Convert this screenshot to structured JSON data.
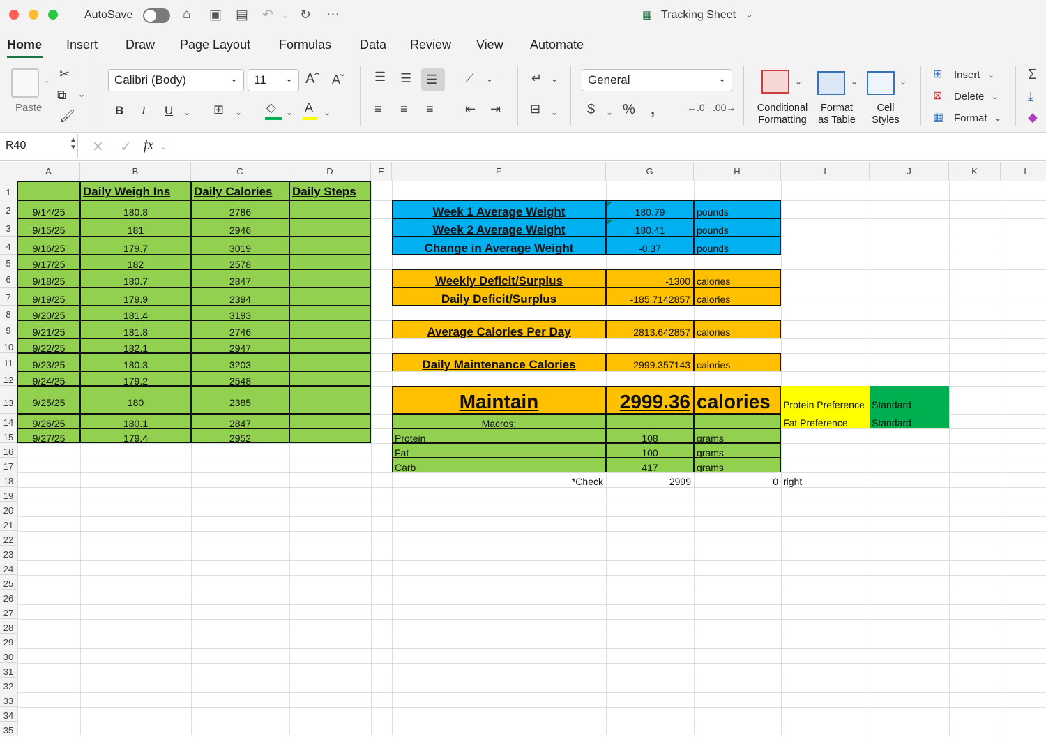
{
  "titlebar": {
    "autosave_label": "AutoSave",
    "document_title": "Tracking Sheet",
    "colors": {
      "close": "#fe5f57",
      "minimize": "#febc2e",
      "maximize": "#28c840"
    }
  },
  "tabs": [
    "Home",
    "Insert",
    "Draw",
    "Page Layout",
    "Formulas",
    "Data",
    "Review",
    "View",
    "Automate"
  ],
  "ribbon": {
    "paste_label": "Paste",
    "font_name": "Calibri (Body)",
    "font_size": "11",
    "number_format": "General",
    "conditional_formatting": [
      "Conditional",
      "Formatting"
    ],
    "format_as_table": [
      "Format",
      "as Table"
    ],
    "cell_styles": [
      "Cell",
      "Styles"
    ],
    "insert_label": "Insert",
    "delete_label": "Delete",
    "format_label": "Format",
    "bold": "B",
    "italic": "I",
    "underline": "U"
  },
  "formula_bar": {
    "name_box": "R40",
    "fx": "fx",
    "formula": ""
  },
  "columns": [
    "A",
    "B",
    "C",
    "D",
    "E",
    "F",
    "G",
    "H",
    "I",
    "J",
    "K",
    "L"
  ],
  "rows": [
    "1",
    "2",
    "3",
    "4",
    "5",
    "6",
    "7",
    "8",
    "9",
    "10",
    "11",
    "12",
    "13",
    "14",
    "15",
    "16",
    "17",
    "18",
    "19",
    "20",
    "21",
    "22",
    "23",
    "24",
    "25",
    "26",
    "27",
    "28",
    "29",
    "30",
    "31",
    "32",
    "33",
    "34",
    "35"
  ],
  "log": {
    "headers": [
      "Daily Weigh Ins",
      "Daily Calories",
      "Daily Steps"
    ],
    "entries": [
      {
        "date": "9/14/25",
        "weight": "180.8",
        "calories": "2786"
      },
      {
        "date": "9/15/25",
        "weight": "181",
        "calories": "2946"
      },
      {
        "date": "9/16/25",
        "weight": "179.7",
        "calories": "3019"
      },
      {
        "date": "9/17/25",
        "weight": "182",
        "calories": "2578"
      },
      {
        "date": "9/18/25",
        "weight": "180.7",
        "calories": "2847"
      },
      {
        "date": "9/19/25",
        "weight": "179.9",
        "calories": "2394"
      },
      {
        "date": "9/20/25",
        "weight": "181.4",
        "calories": "3193"
      },
      {
        "date": "9/21/25",
        "weight": "181.8",
        "calories": "2746"
      },
      {
        "date": "9/22/25",
        "weight": "182.1",
        "calories": "2947"
      },
      {
        "date": "9/23/25",
        "weight": "180.3",
        "calories": "3203"
      },
      {
        "date": "9/24/25",
        "weight": "179.2",
        "calories": "2548"
      },
      {
        "date": "9/25/25",
        "weight": "180",
        "calories": "2385"
      },
      {
        "date": "9/26/25",
        "weight": "180.1",
        "calories": "2847"
      },
      {
        "date": "9/27/25",
        "weight": "179.4",
        "calories": "2952"
      }
    ]
  },
  "summary": {
    "week1_label": "Week 1 Average Weight",
    "week1_value": "180.79",
    "week1_unit": "pounds",
    "week2_label": "Week 2 Average Weight",
    "week2_value": "180.41",
    "week2_unit": "pounds",
    "change_label": "Change in Average Weight",
    "change_value": "-0.37",
    "change_unit": "pounds",
    "weekly_label": "Weekly Deficit/Surplus",
    "weekly_value": "-1300",
    "weekly_unit": "calories",
    "daily_label": "Daily Deficit/Surplus",
    "daily_value": "-185.7142857",
    "daily_unit": "calories",
    "avg_label": "Average Calories Per Day",
    "avg_value": "2813.642857",
    "avg_unit": "calories",
    "maint_label": "Daily Maintenance Calories",
    "maint_value": "2999.357143",
    "maint_unit": "calories",
    "goal_label": "Maintain",
    "goal_value": "2999.36",
    "goal_unit": "calories",
    "protein_pref_label": "Protein Preference",
    "protein_pref_value": "Standard",
    "fat_pref_label": "Fat Preference",
    "fat_pref_value": "Standard",
    "macros_label": "Macros:",
    "protein_label": "Protein",
    "protein_value": "108",
    "protein_unit": "grams",
    "fat_label": "Fat",
    "fat_value": "100",
    "fat_unit": "grams",
    "carb_label": "Carb",
    "carb_value": "417",
    "carb_unit": "grams",
    "check_label": "*Check",
    "check_value": "2999",
    "check_diff": "0",
    "check_status": "right"
  }
}
